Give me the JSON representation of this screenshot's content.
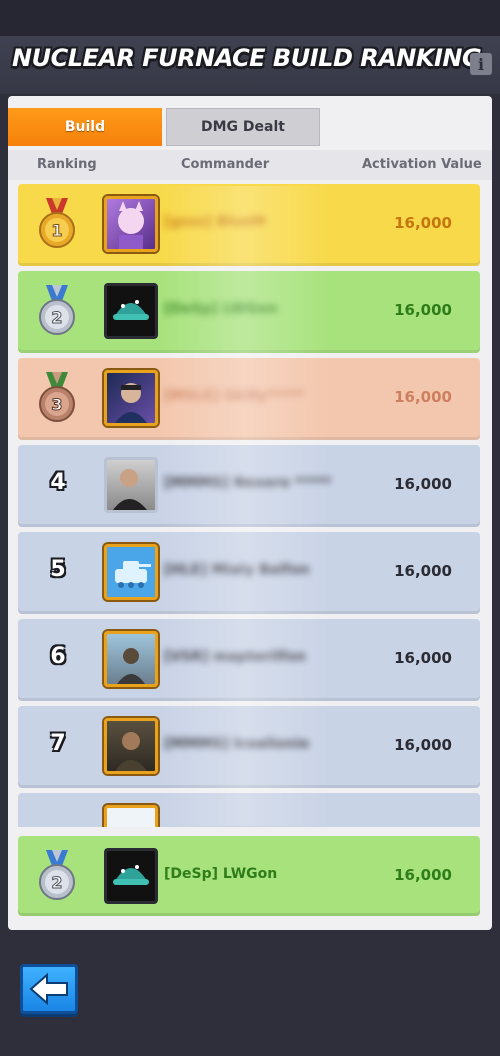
{
  "header": {
    "title": "NUCLEAR FURNACE BUILD RANKING",
    "info_icon": "info-icon"
  },
  "tabs": [
    {
      "label": "Build",
      "active": true
    },
    {
      "label": "DMG Dealt",
      "active": false
    }
  ],
  "columns": {
    "ranking": "Ranking",
    "commander": "Commander",
    "activation_value": "Activation Value"
  },
  "colors": {
    "gold_row": "#f8d94a",
    "silver_row": "#a8e27d",
    "bronze_row": "#f3c7ad",
    "default_row": "#c9d3e6",
    "gold_value": "#c6760f",
    "green_value": "#2f7d1a",
    "bronze_value": "#cc8060",
    "default_value": "#2b2b34",
    "active_tab": "#f5810a"
  },
  "rows": [
    {
      "rank": "1",
      "commander": "[gsss] BlueM",
      "value": "16,000",
      "medal": "gold-medal-icon"
    },
    {
      "rank": "2",
      "commander": "[DeSp] LWGon",
      "value": "16,000",
      "medal": "silver-medal-icon"
    },
    {
      "rank": "3",
      "commander": "[MSLE] Skilly*****",
      "value": "16,000",
      "medal": "bronze-medal-icon"
    },
    {
      "rank": "4",
      "commander": "[MMMS] Nexero *****",
      "value": "16,000"
    },
    {
      "rank": "5",
      "commander": "[HLE] Mialy Balfon",
      "value": "16,000"
    },
    {
      "rank": "6",
      "commander": "[VSR] mapterilfon",
      "value": "16,000"
    },
    {
      "rank": "7",
      "commander": "[MMMS] lcoalionie",
      "value": "16,000"
    }
  ],
  "my_rank": {
    "rank": "2",
    "commander": "[DeSp] LWGon",
    "value": "16,000",
    "medal": "silver-medal-icon"
  },
  "footer": {
    "back_icon": "back-arrow-icon"
  }
}
